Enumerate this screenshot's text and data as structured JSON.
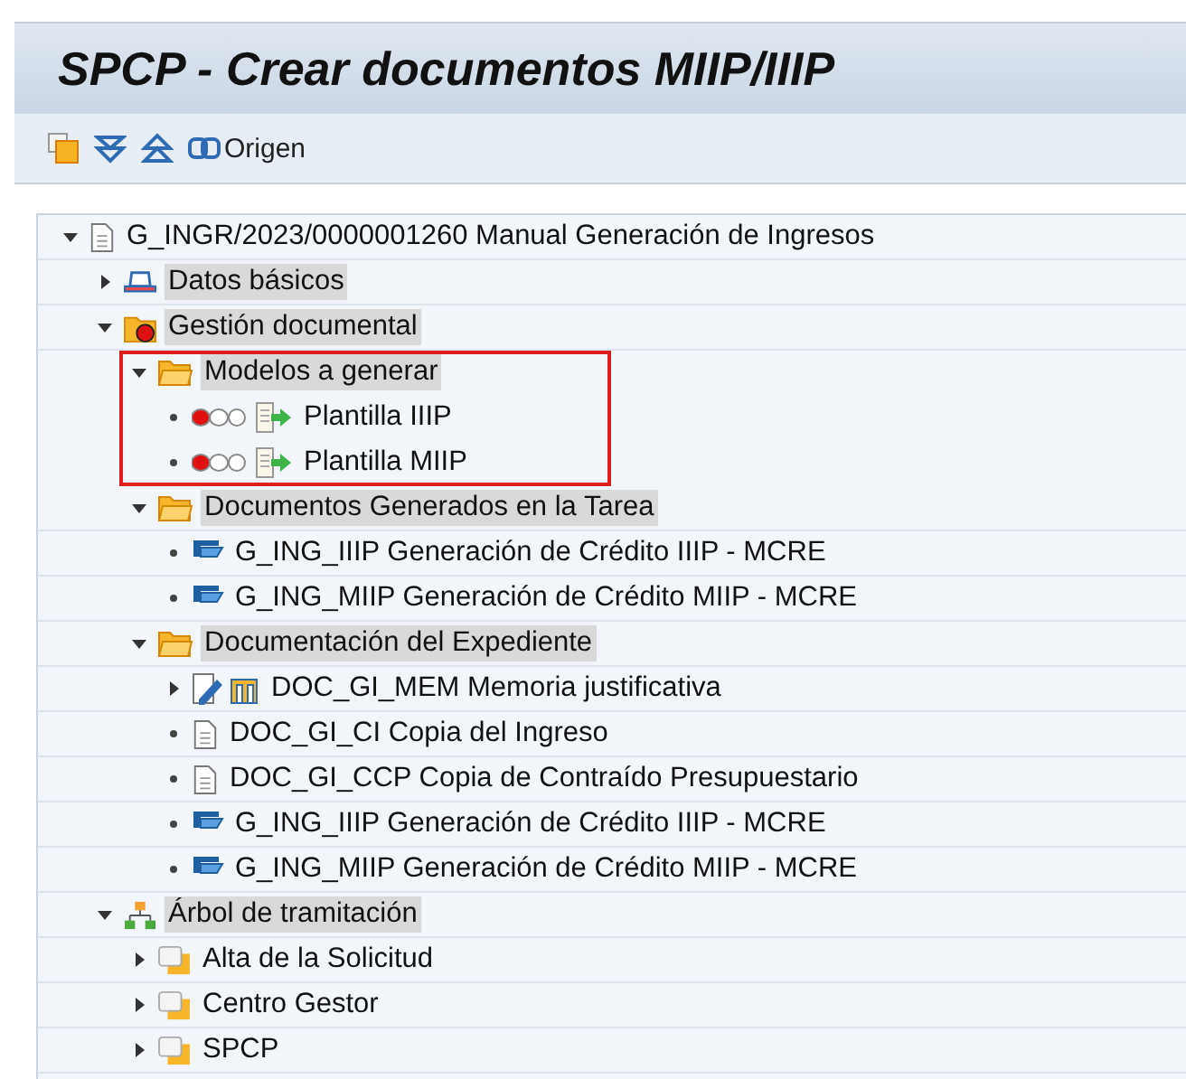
{
  "window": {
    "title": "SPCP - Crear documentos MIIP/IIIP"
  },
  "toolbar": [
    {
      "kind": "copy"
    },
    {
      "kind": "expand"
    },
    {
      "kind": "collapse"
    },
    {
      "kind": "link",
      "label": "Origen"
    }
  ],
  "tree": [
    {
      "label": "G_INGR/2023/0000001260 Manual Generación de Ingresos",
      "kind": "document",
      "expanded": true,
      "highlighted": false,
      "children": [
        {
          "label": "Datos básicos",
          "kind": "hat",
          "expanded": false,
          "highlighted": true
        },
        {
          "label": "Gestión documental",
          "kind": "flagged",
          "expanded": true,
          "highlighted": true,
          "children": [
            {
              "label": "Modelos a generar",
              "kind": "folder",
              "expanded": true,
              "highlighted": true,
              "boxed": true,
              "children": [
                {
                  "label": "Plantilla IIIP",
                  "kind": "template",
                  "highlighted": false
                },
                {
                  "label": "Plantilla MIIP",
                  "kind": "template",
                  "highlighted": false
                }
              ]
            },
            {
              "label": "Documentos Generados en la Tarea",
              "kind": "folder",
              "expanded": true,
              "highlighted": true,
              "children": [
                {
                  "label": "G_ING_IIIP Generación de Crédito IIIP - MCRE",
                  "kind": "form",
                  "highlighted": false
                },
                {
                  "label": "G_ING_MIIP Generación de Crédito MIIP - MCRE",
                  "kind": "form",
                  "highlighted": false
                }
              ]
            },
            {
              "label": "Documentación del Expediente",
              "kind": "folder",
              "expanded": true,
              "highlighted": true,
              "children": [
                {
                  "label": "DOC_GI_MEM Memoria justificativa",
                  "kind": "memo",
                  "expanded": false,
                  "highlighted": false
                },
                {
                  "label": "DOC_GI_CI Copia del Ingreso",
                  "kind": "document",
                  "highlighted": false
                },
                {
                  "label": "DOC_GI_CCP Copia de Contraído Presupuestario",
                  "kind": "document",
                  "highlighted": false
                },
                {
                  "label": "G_ING_IIIP Generación de Crédito IIIP - MCRE",
                  "kind": "form",
                  "highlighted": false
                },
                {
                  "label": "G_ING_MIIP Generación de Crédito MIIP - MCRE",
                  "kind": "form",
                  "highlighted": false
                }
              ]
            }
          ]
        },
        {
          "label": "Árbol de tramitación",
          "kind": "hierarchy",
          "expanded": true,
          "highlighted": true,
          "children": [
            {
              "label": "Alta de la Solicitud",
              "kind": "step",
              "expanded": false,
              "highlighted": false
            },
            {
              "label": "Centro Gestor",
              "kind": "step",
              "expanded": false,
              "highlighted": false
            },
            {
              "label": "SPCP",
              "kind": "step",
              "expanded": false,
              "highlighted": false
            }
          ]
        }
      ]
    }
  ]
}
